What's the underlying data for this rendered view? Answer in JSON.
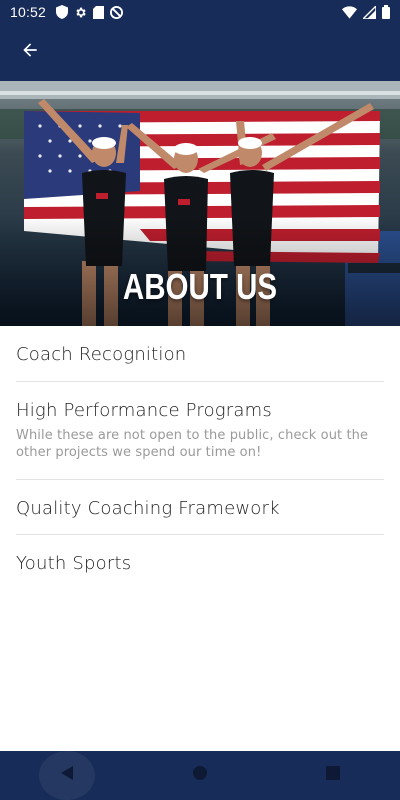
{
  "status_bar": {
    "time": "10:52",
    "left_icons": [
      "shield-icon",
      "gear-icon",
      "sd-card-icon",
      "do-not-disturb-icon"
    ],
    "right_icons": [
      "wifi-icon",
      "cell-signal-icon",
      "battery-icon"
    ]
  },
  "app_bar": {
    "back_icon": "arrow-back-icon"
  },
  "hero": {
    "title": "ABOUT US",
    "image": "water-polo-team-with-usa-flag"
  },
  "list": {
    "items": [
      {
        "title": "Coach Recognition",
        "description": ""
      },
      {
        "title": "High Performance Programs",
        "description": "While these are not open to the public, check out the other projects we spend our time on!"
      },
      {
        "title": "Quality Coaching Framework",
        "description": ""
      },
      {
        "title": "Youth Sports",
        "description": ""
      }
    ]
  },
  "nav_bar": {
    "buttons": [
      "back-triangle-icon",
      "home-circle-icon",
      "recents-square-icon"
    ]
  },
  "colors": {
    "primary_navy": "#182c59",
    "text_dark": "#222222",
    "text_muted": "#9a9a9a",
    "divider": "#e3e3e3"
  }
}
